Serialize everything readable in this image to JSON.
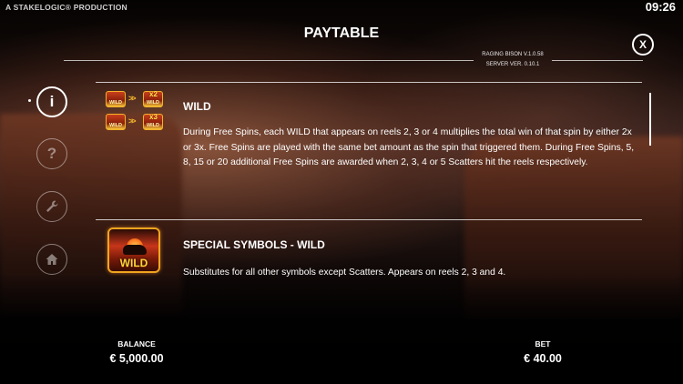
{
  "header": {
    "credit": "A STAKELOGIC® PRODUCTION",
    "clock": "09:26",
    "title": "PAYTABLE",
    "version_line1": "RAGING BISON V.1.0.58",
    "version_line2": "SERVER VER. 0.10.1"
  },
  "nav": {
    "items": [
      {
        "name": "info",
        "glyph": "i",
        "active": true
      },
      {
        "name": "help",
        "glyph": "?",
        "active": false
      },
      {
        "name": "settings",
        "glyph": "wrench-icon",
        "active": false
      },
      {
        "name": "home",
        "glyph": "home-icon",
        "active": false
      }
    ]
  },
  "close_label": "X",
  "sections": [
    {
      "title": "WILD",
      "text": "During Free Spins, each WILD that appears on reels 2, 3 or 4 multiplies the total win of that spin by either 2x or 3x. Free Spins are played with the same bet amount as the spin that triggered them. During Free Spins, 5, 8, 15 or 20 additional Free Spins are awarded when 2, 3, 4 or 5 Scatters hit the reels respectively.",
      "icon_label": "WILD",
      "multipliers": [
        "x2",
        "x3"
      ],
      "arrow": ">>"
    },
    {
      "title": "SPECIAL SYMBOLS - WILD",
      "text": "Substitutes for all other symbols except Scatters. Appears on reels 2, 3 and 4.",
      "icon_label": "WILD"
    }
  ],
  "footer": {
    "balance_label": "BALANCE",
    "balance_value": "€ 5,000.00",
    "bet_label": "BET",
    "bet_value": "€ 40.00"
  },
  "colors": {
    "accent_gold": "#f5b72a",
    "wild_red": "#c7361a",
    "text": "#ffffff"
  }
}
